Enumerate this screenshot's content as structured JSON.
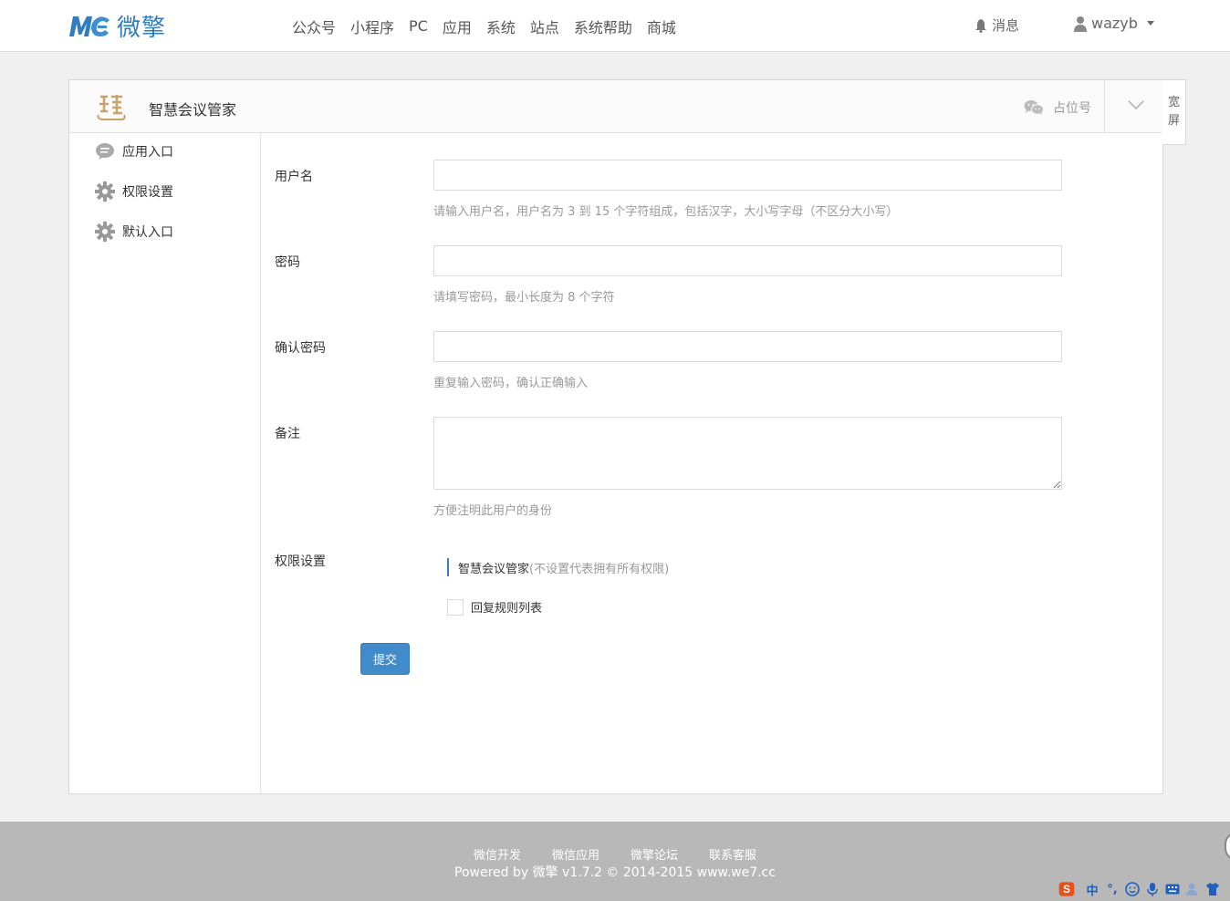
{
  "brand": {
    "logo_mark": "MC",
    "name": "微擎"
  },
  "nav": {
    "items": [
      {
        "label": "公众号"
      },
      {
        "label": "小程序"
      },
      {
        "label": "PC"
      },
      {
        "label": "应用"
      },
      {
        "label": "系统"
      },
      {
        "label": "站点"
      },
      {
        "label": "系统帮助"
      },
      {
        "label": "商城"
      }
    ],
    "messages_label": "消息",
    "username": "wazyb"
  },
  "panel": {
    "account_name": "智慧会议管家",
    "wechat_id": "占位号",
    "wide_label_1": "宽",
    "wide_label_2": "屏"
  },
  "sidebar": {
    "items": [
      {
        "label": "应用入口",
        "icon": "chat-bubble-icon"
      },
      {
        "label": "权限设置",
        "icon": "gear-icon"
      },
      {
        "label": "默认入口",
        "icon": "gear-icon"
      }
    ]
  },
  "form": {
    "username": {
      "label": "用户名",
      "value": "",
      "help": "请输入用户名，用户名为 3 到 15 个字符组成，包括汉字，大小写字母（不区分大小写）"
    },
    "password": {
      "label": "密码",
      "value": "",
      "help": "请填写密码，最小长度为 8 个字符"
    },
    "confirm": {
      "label": "确认密码",
      "value": "",
      "help": "重复输入密码，确认正确输入"
    },
    "remark": {
      "label": "备注",
      "value": "",
      "help": "方便注明此用户的身份"
    },
    "permission": {
      "label": "权限设置",
      "group_name": "智慧会议管家",
      "group_note": "(不设置代表拥有所有权限)",
      "options": [
        {
          "label": "回复规则列表",
          "checked": false
        }
      ]
    },
    "submit_label": "提交"
  },
  "footer": {
    "links": [
      "微信开发",
      "微信应用",
      "微擎论坛",
      "联系客服"
    ],
    "powered": "Powered by 微擎 v1.7.2 © 2014-2015 www.we7.cc"
  },
  "ime": {
    "mode_label": "中",
    "punct_label": "°,"
  },
  "colors": {
    "brand": "#2f7ec1",
    "primary_button": "#428bca",
    "footer_bg": "#b8b8b8"
  }
}
